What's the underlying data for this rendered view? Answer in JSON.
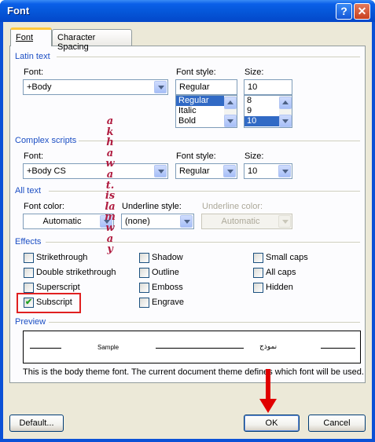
{
  "window": {
    "title": "Font",
    "help_label": "?",
    "close_label": "✕"
  },
  "tabs": [
    {
      "label": "Font"
    },
    {
      "label": "Character Spacing"
    }
  ],
  "latin_text": {
    "section_label": "Latin text",
    "font": {
      "label": "Font:",
      "value": "+Body"
    },
    "font_style": {
      "label": "Font style:",
      "value": "Regular",
      "options": [
        "Regular",
        "Italic",
        "Bold"
      ],
      "selected": "Regular"
    },
    "size": {
      "label": "Size:",
      "value": "10",
      "options": [
        "8",
        "9",
        "10"
      ],
      "selected": "10"
    }
  },
  "complex_scripts": {
    "section_label": "Complex scripts",
    "font": {
      "label": "Font:",
      "value": "+Body CS"
    },
    "font_style": {
      "label": "Font style:",
      "value": "Regular"
    },
    "size": {
      "label": "Size:",
      "value": "10"
    }
  },
  "all_text": {
    "section_label": "All text",
    "font_color": {
      "label": "Font color:",
      "value": "Automatic"
    },
    "underline_style": {
      "label": "Underline style:",
      "value": "(none)"
    },
    "underline_color": {
      "label": "Underline color:",
      "value": "Automatic"
    }
  },
  "effects": {
    "section_label": "Effects",
    "col1": [
      {
        "label": "Strikethrough",
        "checked": false
      },
      {
        "label": "Double strikethrough",
        "checked": false
      },
      {
        "label": "Superscript",
        "checked": false
      },
      {
        "label": "Subscript",
        "checked": true
      }
    ],
    "col2": [
      {
        "label": "Shadow",
        "checked": false
      },
      {
        "label": "Outline",
        "checked": false
      },
      {
        "label": "Emboss",
        "checked": false
      },
      {
        "label": "Engrave",
        "checked": false
      }
    ],
    "col3": [
      {
        "label": "Small caps",
        "checked": false
      },
      {
        "label": "All caps",
        "checked": false
      },
      {
        "label": "Hidden",
        "checked": false
      }
    ]
  },
  "preview": {
    "section_label": "Preview",
    "sample_left": "Sample",
    "sample_right": "نموذج",
    "description": "This is the body theme font. The current document theme defines which font will be used."
  },
  "buttons": {
    "default_label": "Default...",
    "ok_label": "OK",
    "cancel_label": "Cancel"
  },
  "watermark": "akhawat.islamway",
  "colors": {
    "title_bar": "#0a5fe8",
    "section_label": "#1c4fc4",
    "selection": "#316ac5",
    "annotation_red": "#e00000",
    "watermark": "#b01c40"
  }
}
